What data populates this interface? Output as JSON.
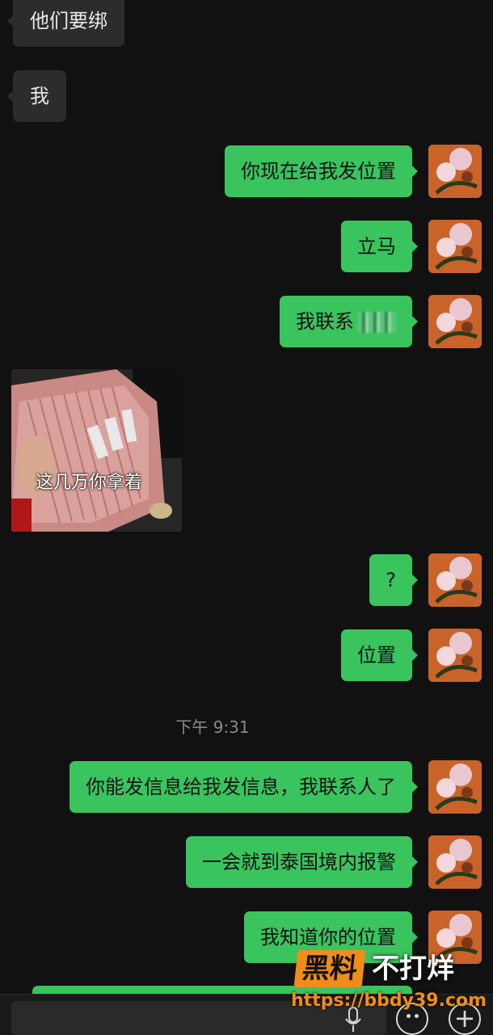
{
  "messages": [
    {
      "side": "in",
      "text": "他们要绑"
    },
    {
      "side": "in",
      "text": "我"
    },
    {
      "side": "out",
      "text": "你现在给我发位置"
    },
    {
      "side": "out",
      "text": "立马"
    },
    {
      "side": "out",
      "text": "我联系"
    },
    {
      "side": "in",
      "type": "image",
      "caption": "这几万你拿着"
    },
    {
      "side": "out",
      "text": "?"
    },
    {
      "side": "out",
      "text": "位置"
    },
    {
      "side": "out",
      "text": "你能发信息给我发信息，我联系人了"
    },
    {
      "side": "out",
      "text": "一会就到泰国境内报警"
    },
    {
      "side": "out",
      "text": "我知道你的位置"
    }
  ],
  "timestamp": "下午 9:31",
  "watermark": {
    "badge": "黑料",
    "text": "不打烊",
    "url": "https://bbdy39.com"
  },
  "icons": {
    "voice": "microphone-icon",
    "emoji": "emoji-icon",
    "more": "plus-icon"
  },
  "colors": {
    "background": "#111111",
    "incoming_bubble": "#2c2c2c",
    "outgoing_bubble": "#39c45e",
    "watermark_accent": "#f08c1a"
  }
}
